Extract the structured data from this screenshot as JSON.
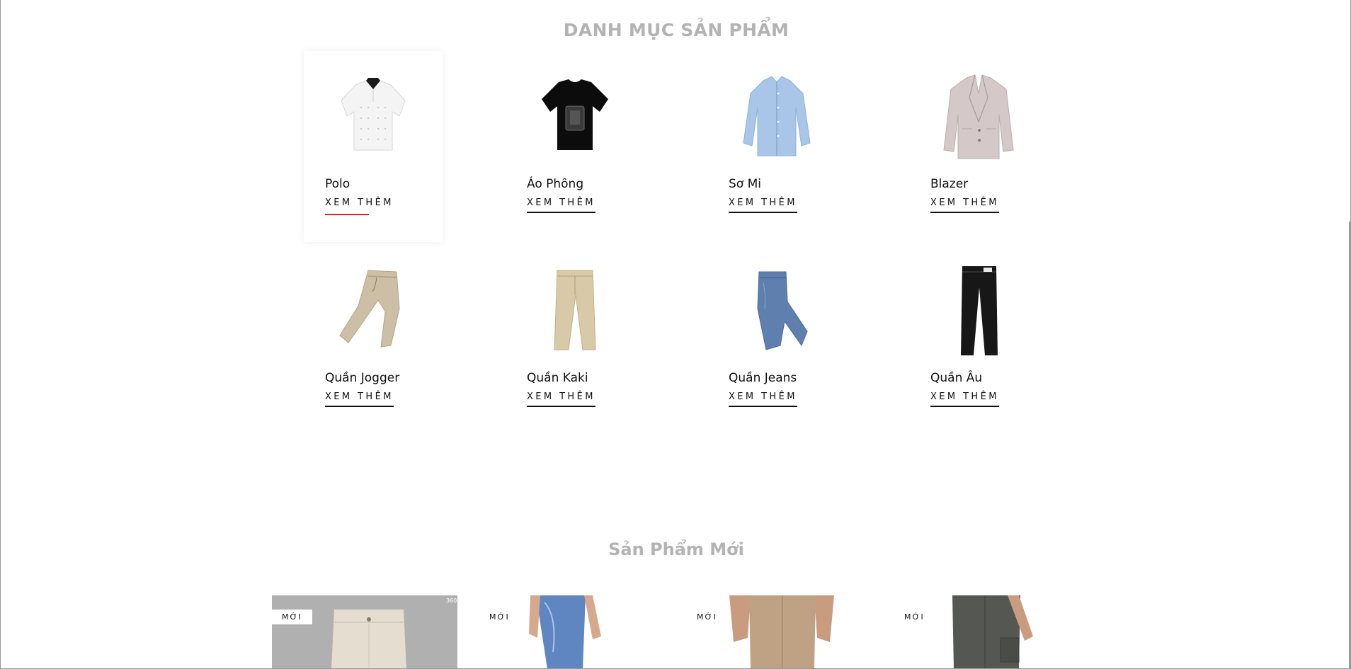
{
  "sections": {
    "categories_title": "DANH MỤC SẢN PHẨM",
    "new_products_title": "Sản Phẩm Mới"
  },
  "categories": [
    {
      "name": "Polo",
      "link": "XEM THÊM",
      "icon": "polo-shirt-icon"
    },
    {
      "name": "Áo Phông",
      "link": "XEM THÊM",
      "icon": "t-shirt-icon"
    },
    {
      "name": "Sơ Mi",
      "link": "XEM THÊM",
      "icon": "dress-shirt-icon"
    },
    {
      "name": "Blazer",
      "link": "XEM THÊM",
      "icon": "blazer-icon"
    },
    {
      "name": "Quần Jogger",
      "link": "XEM THÊM",
      "icon": "jogger-pants-icon"
    },
    {
      "name": "Quần Kaki",
      "link": "XEM THÊM",
      "icon": "khaki-pants-icon"
    },
    {
      "name": "Quần Jeans",
      "link": "XEM THÊM",
      "icon": "jeans-icon"
    },
    {
      "name": "Quần Âu",
      "link": "XEM THÊM",
      "icon": "trousers-icon"
    }
  ],
  "new_products": [
    {
      "badge": "MỚI"
    },
    {
      "badge": "MỚI"
    },
    {
      "badge": "MỚI"
    },
    {
      "badge": "MỚI"
    }
  ],
  "colors": {
    "title_gray": "#b3b3b3",
    "text": "#111111",
    "hover_underline": "#e02424"
  }
}
